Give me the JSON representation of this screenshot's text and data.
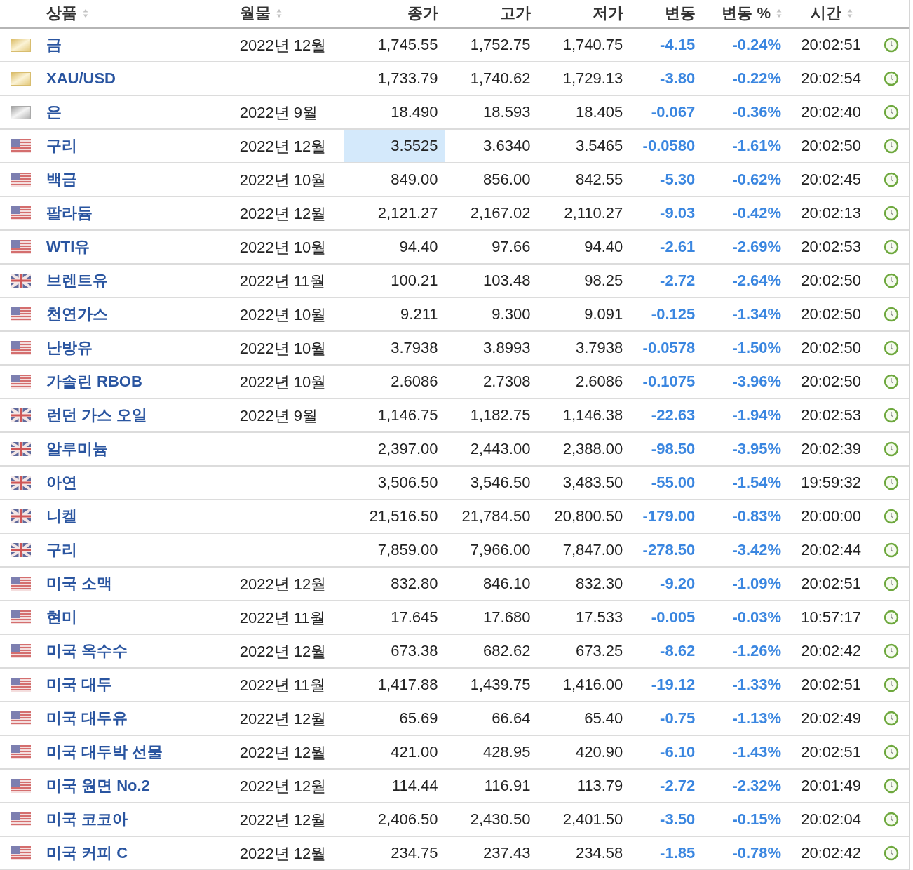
{
  "columns": [
    {
      "label": "상품",
      "sortable": true
    },
    {
      "label": "월물",
      "sortable": true
    },
    {
      "label": "종가",
      "sortable": false
    },
    {
      "label": "고가",
      "sortable": false
    },
    {
      "label": "저가",
      "sortable": false
    },
    {
      "label": "변동",
      "sortable": false
    },
    {
      "label": "변동 %",
      "sortable": true
    },
    {
      "label": "시간",
      "sortable": true
    }
  ],
  "rows": [
    {
      "kind": "gold",
      "name": "금",
      "month": "2022년 12월",
      "close": "1,745.55",
      "high": "1,752.75",
      "low": "1,740.75",
      "change": "-4.15",
      "pct": "-0.24%",
      "time": "20:02:51",
      "highlighted": false
    },
    {
      "kind": "gold",
      "name": "XAU/USD",
      "close": "1,733.79",
      "high": "1,740.62",
      "low": "1,729.13",
      "change": "-3.80",
      "pct": "-0.22%",
      "time": "20:02:54",
      "highlighted": false
    },
    {
      "kind": "silver",
      "name": "은",
      "month": "2022년 9월",
      "close": "18.490",
      "high": "18.593",
      "low": "18.405",
      "change": "-0.067",
      "pct": "-0.36%",
      "time": "20:02:40",
      "highlighted": false
    },
    {
      "kind": "us",
      "name": "구리",
      "month": "2022년 12월",
      "close": "3.5525",
      "high": "3.6340",
      "low": "3.5465",
      "change": "-0.0580",
      "pct": "-1.61%",
      "time": "20:02:50",
      "highlighted": true
    },
    {
      "kind": "us",
      "name": "백금",
      "month": "2022년 10월",
      "close": "849.00",
      "high": "856.00",
      "low": "842.55",
      "change": "-5.30",
      "pct": "-0.62%",
      "time": "20:02:45",
      "highlighted": false
    },
    {
      "kind": "us",
      "name": "팔라듐",
      "month": "2022년 12월",
      "close": "2,121.27",
      "high": "2,167.02",
      "low": "2,110.27",
      "change": "-9.03",
      "pct": "-0.42%",
      "time": "20:02:13",
      "highlighted": false
    },
    {
      "kind": "us",
      "name": "WTI유",
      "month": "2022년 10월",
      "close": "94.40",
      "high": "97.66",
      "low": "94.40",
      "change": "-2.61",
      "pct": "-2.69%",
      "time": "20:02:53",
      "highlighted": false
    },
    {
      "kind": "uk",
      "name": "브렌트유",
      "month": "2022년 11월",
      "close": "100.21",
      "high": "103.48",
      "low": "98.25",
      "change": "-2.72",
      "pct": "-2.64%",
      "time": "20:02:50",
      "highlighted": false
    },
    {
      "kind": "us",
      "name": "천연가스",
      "month": "2022년 10월",
      "close": "9.211",
      "high": "9.300",
      "low": "9.091",
      "change": "-0.125",
      "pct": "-1.34%",
      "time": "20:02:50",
      "highlighted": false
    },
    {
      "kind": "us",
      "name": "난방유",
      "month": "2022년 10월",
      "close": "3.7938",
      "high": "3.8993",
      "low": "3.7938",
      "change": "-0.0578",
      "pct": "-1.50%",
      "time": "20:02:50",
      "highlighted": false
    },
    {
      "kind": "us",
      "name": "가솔린 RBOB",
      "month": "2022년 10월",
      "close": "2.6086",
      "high": "2.7308",
      "low": "2.6086",
      "change": "-0.1075",
      "pct": "-3.96%",
      "time": "20:02:50",
      "highlighted": false
    },
    {
      "kind": "uk",
      "name": "런던 가스 오일",
      "month": "2022년 9월",
      "close": "1,146.75",
      "high": "1,182.75",
      "low": "1,146.38",
      "change": "-22.63",
      "pct": "-1.94%",
      "time": "20:02:53",
      "highlighted": false
    },
    {
      "kind": "uk",
      "name": "알루미늄",
      "close": "2,397.00",
      "high": "2,443.00",
      "low": "2,388.00",
      "change": "-98.50",
      "pct": "-3.95%",
      "time": "20:02:39",
      "highlighted": false
    },
    {
      "kind": "uk",
      "name": "아연",
      "close": "3,506.50",
      "high": "3,546.50",
      "low": "3,483.50",
      "change": "-55.00",
      "pct": "-1.54%",
      "time": "19:59:32",
      "highlighted": false
    },
    {
      "kind": "uk",
      "name": "니켈",
      "close": "21,516.50",
      "high": "21,784.50",
      "low": "20,800.50",
      "change": "-179.00",
      "pct": "-0.83%",
      "time": "20:00:00",
      "highlighted": false
    },
    {
      "kind": "uk",
      "name": "구리",
      "close": "7,859.00",
      "high": "7,966.00",
      "low": "7,847.00",
      "change": "-278.50",
      "pct": "-3.42%",
      "time": "20:02:44",
      "highlighted": false
    },
    {
      "kind": "us",
      "name": "미국 소맥",
      "month": "2022년 12월",
      "close": "832.80",
      "high": "846.10",
      "low": "832.30",
      "change": "-9.20",
      "pct": "-1.09%",
      "time": "20:02:51",
      "highlighted": false
    },
    {
      "kind": "us",
      "name": "현미",
      "month": "2022년 11월",
      "close": "17.645",
      "high": "17.680",
      "low": "17.533",
      "change": "-0.005",
      "pct": "-0.03%",
      "time": "10:57:17",
      "highlighted": false
    },
    {
      "kind": "us",
      "name": "미국 옥수수",
      "month": "2022년 12월",
      "close": "673.38",
      "high": "682.62",
      "low": "673.25",
      "change": "-8.62",
      "pct": "-1.26%",
      "time": "20:02:42",
      "highlighted": false
    },
    {
      "kind": "us",
      "name": "미국 대두",
      "month": "2022년 11월",
      "close": "1,417.88",
      "high": "1,439.75",
      "low": "1,416.00",
      "change": "-19.12",
      "pct": "-1.33%",
      "time": "20:02:51",
      "highlighted": false
    },
    {
      "kind": "us",
      "name": "미국 대두유",
      "month": "2022년 12월",
      "close": "65.69",
      "high": "66.64",
      "low": "65.40",
      "change": "-0.75",
      "pct": "-1.13%",
      "time": "20:02:49",
      "highlighted": false
    },
    {
      "kind": "us",
      "name": "미국 대두박 선물",
      "month": "2022년 12월",
      "close": "421.00",
      "high": "428.95",
      "low": "420.90",
      "change": "-6.10",
      "pct": "-1.43%",
      "time": "20:02:51",
      "highlighted": false
    },
    {
      "kind": "us",
      "name": "미국 원면 No.2",
      "month": "2022년 12월",
      "close": "114.44",
      "high": "116.91",
      "low": "113.79",
      "change": "-2.72",
      "pct": "-2.32%",
      "time": "20:01:49",
      "highlighted": false
    },
    {
      "kind": "us",
      "name": "미국 코코아",
      "month": "2022년 12월",
      "close": "2,406.50",
      "high": "2,430.50",
      "low": "2,401.50",
      "change": "-3.50",
      "pct": "-0.15%",
      "time": "20:02:04",
      "highlighted": false
    },
    {
      "kind": "us",
      "name": "미국 커피 C",
      "month": "2022년 12월",
      "close": "234.75",
      "high": "237.43",
      "low": "234.58",
      "change": "-1.85",
      "pct": "-0.78%",
      "time": "20:02:42",
      "highlighted": false
    }
  ]
}
